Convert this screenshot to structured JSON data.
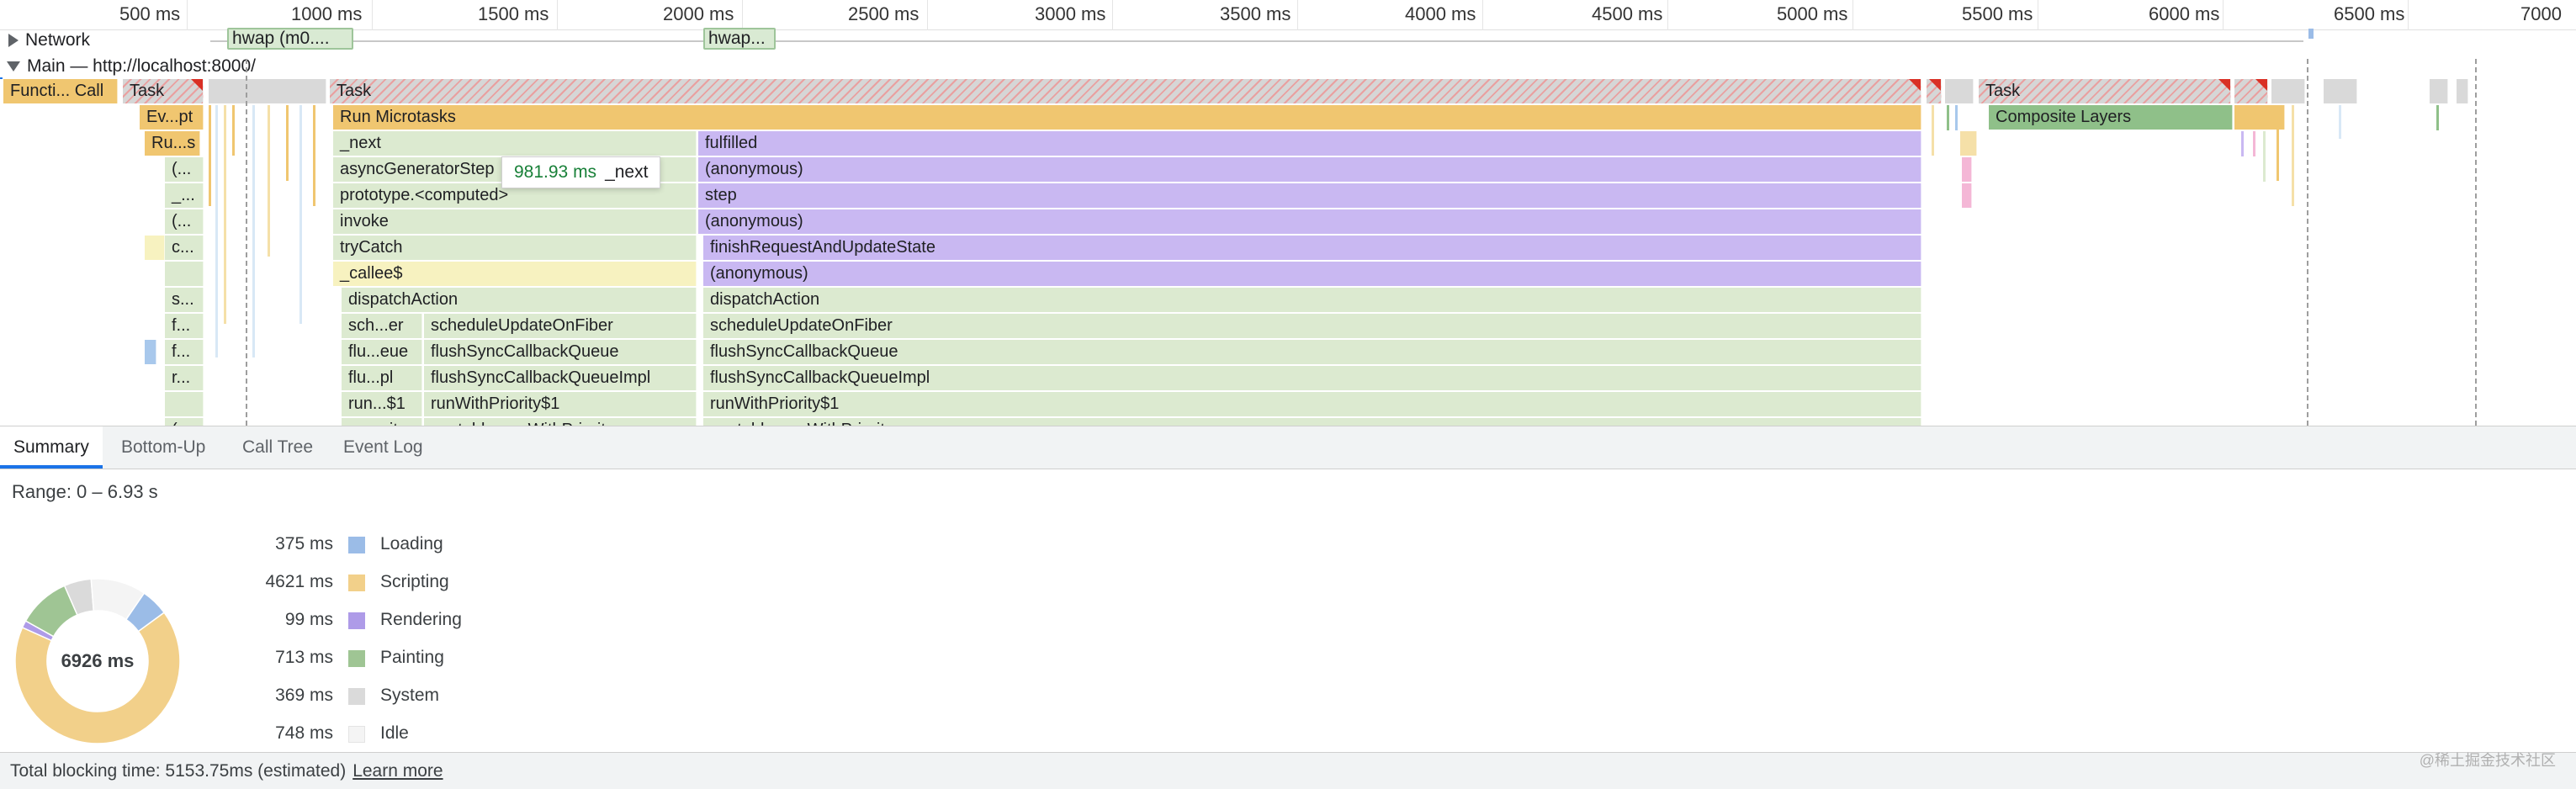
{
  "ruler": {
    "ticks": [
      "500 ms",
      "1000 ms",
      "1500 ms",
      "2000 ms",
      "2500 ms",
      "3000 ms",
      "3500 ms",
      "4000 ms",
      "4500 ms",
      "5000 ms",
      "5500 ms",
      "6000 ms",
      "6500 ms",
      "7000"
    ]
  },
  "tracks": {
    "network_label": "Network",
    "main_label": "Main — http://localhost:8000/"
  },
  "network": {
    "request1": "hwap (m0....",
    "request2": "hwap..."
  },
  "flame": {
    "row0": {
      "a": "Functi... Call",
      "b": "Task",
      "c": "Task",
      "d": "Task"
    },
    "row1": {
      "a": "Ev...pt",
      "b": "Run Microtasks",
      "c": "Composite Layers"
    },
    "row2": {
      "a": "Ru...s",
      "b": "_next",
      "c": "fulfilled"
    },
    "row3": {
      "a": "(...",
      "b": "asyncGeneratorStep",
      "c": "(anonymous)"
    },
    "row4": {
      "a": "_...",
      "b": "prototype.<computed>",
      "c": "step"
    },
    "row5": {
      "a": "(...",
      "b": "invoke",
      "c": "(anonymous)"
    },
    "row6": {
      "a": "c...",
      "b": "tryCatch",
      "c": "finishRequestAndUpdateState"
    },
    "row7": {
      "b": "_callee$",
      "c": "(anonymous)"
    },
    "row8": {
      "a": "s...",
      "b": "dispatchAction",
      "c": "dispatchAction"
    },
    "row9": {
      "a": "f...",
      "b1": "sch...er",
      "b2": "scheduleUpdateOnFiber",
      "c": "scheduleUpdateOnFiber"
    },
    "row10": {
      "a": "f...",
      "b1": "flu...eue",
      "b2": "flushSyncCallbackQueue",
      "c": "flushSyncCallbackQueue"
    },
    "row11": {
      "a": "r...",
      "b1": "flu...pl",
      "b2": "flushSyncCallbackQueueImpl",
      "c": "flushSyncCallbackQueueImpl"
    },
    "row12": {
      "b1": "run...$1",
      "b2": "runWithPriority$1",
      "c": "runWithPriority$1"
    },
    "row13": {
      "a": "(...",
      "b1": "uns...ity",
      "b2": "unstable_runWithPriority",
      "c": "unstable_runWithPriority"
    }
  },
  "tooltip": {
    "duration": "981.93 ms",
    "name": "_next"
  },
  "tabs": [
    "Summary",
    "Bottom-Up",
    "Call Tree",
    "Event Log"
  ],
  "summary": {
    "range": "Range: 0 – 6.93 s",
    "total": "6926 ms",
    "categories": [
      {
        "value": "375 ms",
        "label": "Loading",
        "color": "#9bbce7",
        "ms": 375
      },
      {
        "value": "4621 ms",
        "label": "Scripting",
        "color": "#f2d08a",
        "ms": 4621
      },
      {
        "value": "99 ms",
        "label": "Rendering",
        "color": "#ae9be8",
        "ms": 99
      },
      {
        "value": "713 ms",
        "label": "Painting",
        "color": "#9fc594",
        "ms": 713
      },
      {
        "value": "369 ms",
        "label": "System",
        "color": "#dadada",
        "ms": 369
      },
      {
        "value": "748 ms",
        "label": "Idle",
        "color": "#f4f4f4",
        "ms": 748
      }
    ]
  },
  "footer": {
    "text": "Total blocking time: 5153.75ms (estimated)",
    "link": "Learn more"
  },
  "watermark": "@稀土掘金技术社区"
}
